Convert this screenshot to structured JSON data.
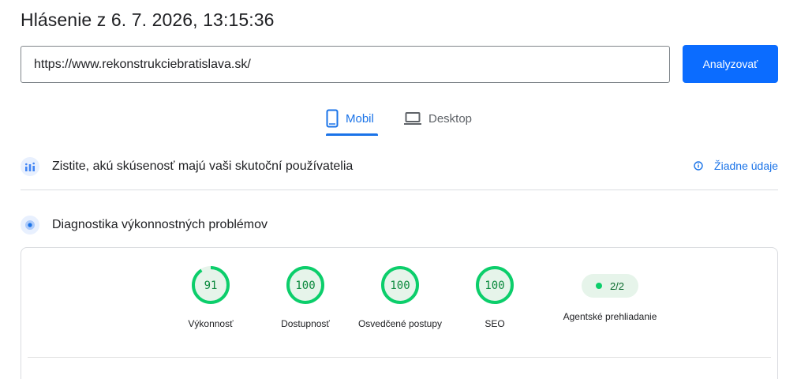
{
  "header": {
    "title": "Hlásenie z 6. 7. 2026, 13:15:36"
  },
  "search": {
    "url_value": "https://www.rekonstrukciebratislava.sk/",
    "analyze_label": "Analyzovať"
  },
  "tabs": [
    {
      "label": "Mobil",
      "icon": "smartphone-icon",
      "selected": true
    },
    {
      "label": "Desktop",
      "icon": "laptop-icon",
      "selected": false
    }
  ],
  "crux": {
    "text": "Zistite, akú skúsenosť majú vaši skutoční používatelia",
    "no_data_label": "Žiadne údaje",
    "icon": "users-chart-icon"
  },
  "diagnostics": {
    "text": "Diagnostika výkonnostných problémov",
    "icon": "lighthouse-icon"
  },
  "scores": [
    {
      "value": "91",
      "fraction": 0.91,
      "label": "Výkonnosť"
    },
    {
      "value": "100",
      "fraction": 1.0,
      "label": "Dostupnosť"
    },
    {
      "value": "100",
      "fraction": 1.0,
      "label": "Osvedčené postupy"
    },
    {
      "value": "100",
      "fraction": 1.0,
      "label": "SEO"
    }
  ],
  "agent": {
    "value": "2/2",
    "label": "Agentské prehliadanie"
  },
  "colors": {
    "accent": "#1a73e8",
    "button": "#0b6cff",
    "pass_green": "#0cce6b",
    "pass_fill": "#e6f4ea"
  }
}
